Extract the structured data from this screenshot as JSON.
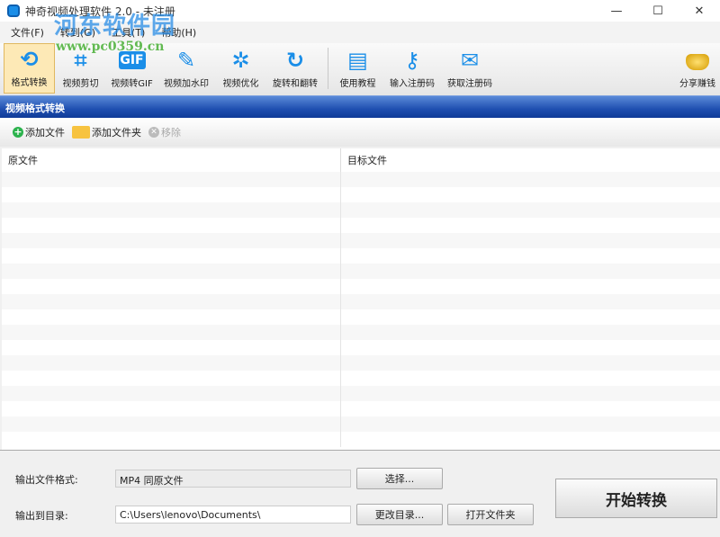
{
  "window": {
    "title": "神奇视频处理软件 2.0 - 未注册",
    "min": "—",
    "max": "☐",
    "close": "✕"
  },
  "menu": [
    "文件(F)",
    "转到(G)",
    "工具(T)",
    "帮助(H)"
  ],
  "toolbar": [
    "格式转换",
    "视频剪切",
    "视频转GIF",
    "视频加水印",
    "视频优化",
    "旋转和翻转",
    "使用教程",
    "输入注册码",
    "获取注册码"
  ],
  "toolbar_icons": [
    "⟲",
    "⌗",
    "GIF",
    "✎",
    "✲",
    "↻",
    "▤",
    "⚷",
    "✉"
  ],
  "share": "分享赚钱",
  "section_title": "视频格式转换",
  "subbar": {
    "add_file": "添加文件",
    "add_folder": "添加文件夹",
    "remove": "移除"
  },
  "table": {
    "col_source": "原文件",
    "col_target": "目标文件"
  },
  "bottom": {
    "format_label": "输出文件格式:",
    "format_value": "MP4 同原文件",
    "select": "选择...",
    "dir_label": "输出到目录:",
    "dir_value": "C:\\Users\\lenovo\\Documents\\",
    "change_dir": "更改目录...",
    "open_folder": "打开文件夹",
    "start": "开始转换"
  },
  "watermark": {
    "name": "河东软件园",
    "url": "www.pc0359.cn"
  }
}
